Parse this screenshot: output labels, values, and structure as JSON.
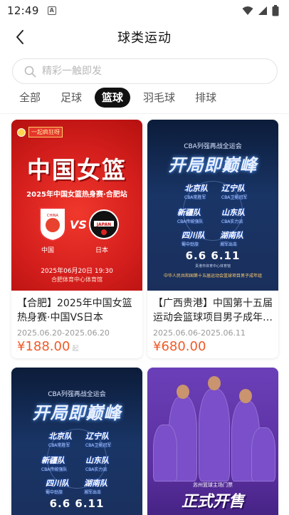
{
  "status_bar": {
    "time": "12:49",
    "sim_label": "A"
  },
  "header": {
    "title": "球类运动"
  },
  "search": {
    "placeholder": "精彩一触即发",
    "value": ""
  },
  "tabs": [
    {
      "label": "全部",
      "active": false
    },
    {
      "label": "足球",
      "active": false
    },
    {
      "label": "篮球",
      "active": true
    },
    {
      "label": "羽毛球",
      "active": false
    },
    {
      "label": "排球",
      "active": false
    }
  ],
  "colors": {
    "price": "#f05a28",
    "active_tab_bg": "#111111",
    "poster_red": "#d51f1d",
    "poster_blue": "#193566",
    "poster_purple": "#5a2f9e"
  },
  "cards": [
    {
      "title": "【合肥】2025年中国女篮热身赛·中国VS日本",
      "date": "2025.06.20-2025.06.20",
      "price": "¥188.00",
      "price_tail": "起",
      "poster": {
        "badge": "一起疯狂呀",
        "headline": "中国女篮",
        "subtitle": "2025年中国女篮热身赛·合肥站",
        "vs": "VS",
        "team_left_logo": "CHINA",
        "team_right_logo": "JAPAN",
        "team_left": "中国",
        "team_right": "日本",
        "datetime": "2025年06月20日 19:30",
        "venue": "合肥体育中心体育馆"
      }
    },
    {
      "title": "【广西贵港】中国第十五届运动会篮球项目男子成年…",
      "date": "2025.06.06-2025.06.11",
      "price": "¥680.00",
      "poster": {
        "org": "CBA列强再战全运会",
        "slogan": "开局即巅峰",
        "teams": [
          {
            "name": "北京队",
            "sub": "CBA常胜军"
          },
          {
            "name": "辽宁队",
            "sub": "CBA卫冕冠军"
          },
          {
            "name": "新疆队",
            "sub": "CBA传统强队"
          },
          {
            "name": "山东队",
            "sub": "CBA实力派"
          },
          {
            "name": "四川队",
            "sub": "蜀中劲旅"
          },
          {
            "name": "湖南队",
            "sub": "湘军出击"
          }
        ],
        "dates": "6.6    6.11",
        "venue": "贵港市体育中心体育馆",
        "footer": "中华人民共和国第十五届运动会篮球项目男子成年组"
      }
    },
    {
      "title": "",
      "date": "",
      "price": "",
      "poster": {
        "org": "CBA列强再战全运会",
        "slogan": "开局即巅峰",
        "teams": [
          {
            "name": "北京队",
            "sub": "CBA常胜军"
          },
          {
            "name": "辽宁队",
            "sub": "CBA卫冕冠军"
          },
          {
            "name": "新疆队",
            "sub": "CBA传统强队"
          },
          {
            "name": "山东队",
            "sub": "CBA实力派"
          },
          {
            "name": "四川队",
            "sub": "蜀中劲旅"
          },
          {
            "name": "湖南队",
            "sub": "湘军出击"
          }
        ],
        "dates": "6.6    6.11"
      }
    },
    {
      "title": "",
      "date": "",
      "price": "",
      "poster": {
        "ribbon": "苏州篮球主场门票",
        "headline": "正式开售"
      }
    }
  ]
}
